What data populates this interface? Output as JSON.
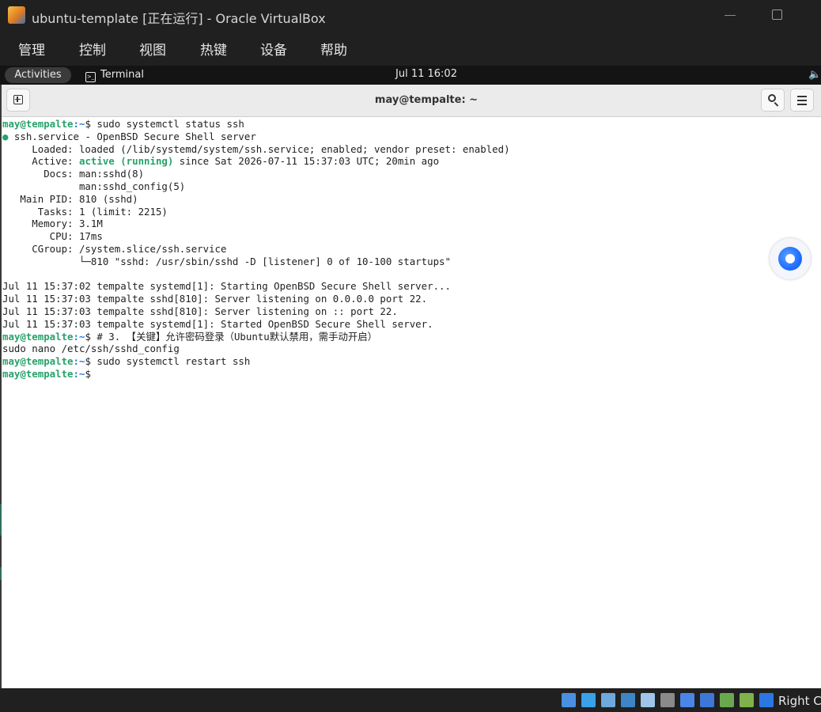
{
  "window": {
    "title": "ubuntu-template  [正在运行] - Oracle VirtualBox",
    "app_icon": "virtualbox-icon"
  },
  "host_menu": [
    "管理",
    "控制",
    "视图",
    "热键",
    "设备",
    "帮助"
  ],
  "gnome": {
    "activities": "Activities",
    "app_name": "Terminal",
    "clock": "Jul 11  16:02",
    "sound_icon": "speaker-icon"
  },
  "terminal": {
    "title": "may@tempalte: ~",
    "prompt_user": "may@tempalte",
    "prompt_path": ":~",
    "prompt_sym": "$ ",
    "lines": [
      {
        "kind": "prompt",
        "cmd": "sudo systemctl status ssh"
      },
      {
        "kind": "dot",
        "dot": "●",
        "text": " ssh.service - OpenBSD Secure Shell server"
      },
      {
        "kind": "text",
        "text": "     Loaded: loaded (/lib/systemd/system/ssh.service; enabled; vendor preset: enabled)"
      },
      {
        "kind": "active",
        "pre": "     Active: ",
        "status": "active (running)",
        "post": " since Sat 2026-07-11 15:37:03 UTC; 20min ago"
      },
      {
        "kind": "text",
        "text": "       Docs: man:sshd(8)"
      },
      {
        "kind": "text",
        "text": "             man:sshd_config(5)"
      },
      {
        "kind": "text",
        "text": "   Main PID: 810 (sshd)"
      },
      {
        "kind": "text",
        "text": "      Tasks: 1 (limit: 2215)"
      },
      {
        "kind": "text",
        "text": "     Memory: 3.1M"
      },
      {
        "kind": "text",
        "text": "        CPU: 17ms"
      },
      {
        "kind": "text",
        "text": "     CGroup: /system.slice/ssh.service"
      },
      {
        "kind": "text",
        "text": "             └─810 \"sshd: /usr/sbin/sshd -D [listener] 0 of 10-100 startups\""
      },
      {
        "kind": "text",
        "text": ""
      },
      {
        "kind": "text",
        "text": "Jul 11 15:37:02 tempalte systemd[1]: Starting OpenBSD Secure Shell server..."
      },
      {
        "kind": "text",
        "text": "Jul 11 15:37:03 tempalte sshd[810]: Server listening on 0.0.0.0 port 22."
      },
      {
        "kind": "text",
        "text": "Jul 11 15:37:03 tempalte sshd[810]: Server listening on :: port 22."
      },
      {
        "kind": "text",
        "text": "Jul 11 15:37:03 tempalte systemd[1]: Started OpenBSD Secure Shell server."
      },
      {
        "kind": "prompt",
        "cmd": "# 3. 【关键】允许密码登录（Ubuntu默认禁用，需手动开启）"
      },
      {
        "kind": "text",
        "text": "sudo nano /etc/ssh/sshd_config"
      },
      {
        "kind": "prompt",
        "cmd": "sudo systemctl restart ssh"
      },
      {
        "kind": "prompt",
        "cmd": ""
      }
    ]
  },
  "statusbar": {
    "icons": [
      {
        "name": "hard-disk-icon",
        "color": "#4a90e2"
      },
      {
        "name": "optical-drive-icon",
        "color": "#3aa0e8"
      },
      {
        "name": "audio-icon",
        "color": "#6fa8dc"
      },
      {
        "name": "network-icon",
        "color": "#3d85c6"
      },
      {
        "name": "usb-icon",
        "color": "#9fc5e8"
      },
      {
        "name": "shared-folders-icon",
        "color": "#8a8a8a"
      },
      {
        "name": "display-icon",
        "color": "#4a86e8"
      },
      {
        "name": "recording-icon",
        "color": "#3d78d8"
      },
      {
        "name": "cpu-icon",
        "color": "#6aa84f"
      },
      {
        "name": "mouse-integration-icon",
        "color": "#7fb24a"
      },
      {
        "name": "keyboard-capture-icon",
        "color": "#2b78e4"
      }
    ],
    "host_key": "Right Ct"
  }
}
